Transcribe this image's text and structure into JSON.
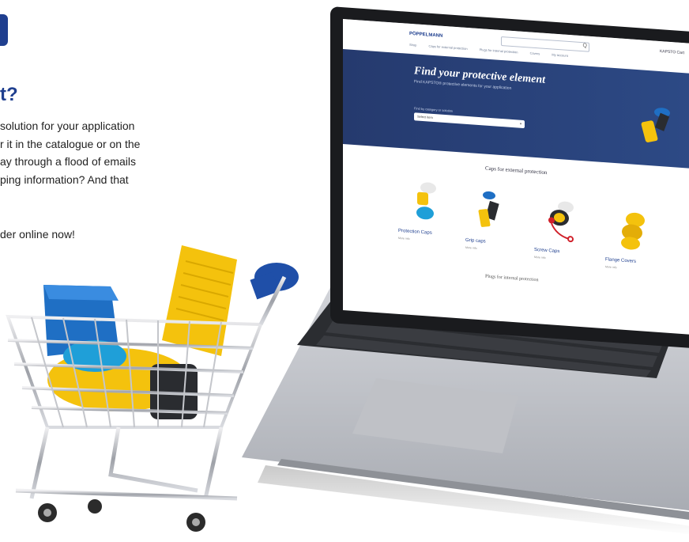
{
  "left_copy": {
    "headline": "t?",
    "lines": [
      "solution for your application",
      "r it in the catalogue or on the",
      "ay through a flood of emails",
      "ping information? And that"
    ],
    "cta": "der online now!"
  },
  "screen": {
    "logo": "PÖPPELMANN",
    "search_icon": "Q",
    "user": "KAPSTO  Cart",
    "nav": [
      "Shop",
      "Caps for external protection",
      "Plugs for internal protection",
      "Covers",
      "My account"
    ],
    "hero_title": "Find your protective element",
    "hero_subtitle": "Find KAPSTO® protective elements for your application",
    "filter_label": "Find by category or solution",
    "select_value": "Select item",
    "section_title": "Caps for external protection",
    "cards": [
      {
        "label": "Protection Caps",
        "sub": "More info"
      },
      {
        "label": "Grip caps",
        "sub": "More info"
      },
      {
        "label": "Screw Caps",
        "sub": "More info"
      },
      {
        "label": "Flange Covers",
        "sub": "More info"
      }
    ],
    "section2_title": "Plugs for internal protection"
  },
  "colors": {
    "brand_blue": "#1f3f8f",
    "hero_blue": "#253a6e",
    "cap_yellow": "#f4c20d",
    "cap_blue": "#1f6fc4",
    "cap_red": "#d0202a"
  }
}
